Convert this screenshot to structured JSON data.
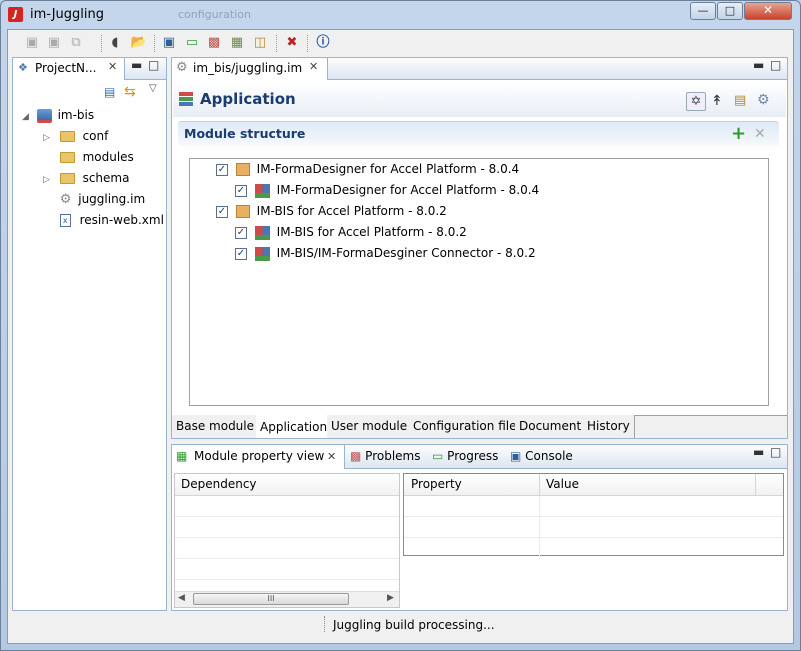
{
  "window": {
    "title": "im-Juggling",
    "ghost_tab": "configuration",
    "app_icon": "J"
  },
  "toolbar": {
    "icons": [
      "save-icon",
      "save-as-icon",
      "save-all-icon",
      "build-icon",
      "open-folder-icon",
      "deploy-icon",
      "add-module-icon",
      "user-config-icon",
      "image-icon",
      "hierarchy-icon",
      "tools-icon",
      "info-icon"
    ]
  },
  "project_view": {
    "tab_label": "ProjectN...",
    "tree": {
      "root": "im-bis",
      "children": [
        {
          "label": "conf",
          "expandable": true
        },
        {
          "label": "modules",
          "expandable": false
        },
        {
          "label": "schema",
          "expandable": true
        },
        {
          "label": "juggling.im",
          "expandable": false
        },
        {
          "label": "resin-web.xml",
          "expandable": false
        }
      ]
    }
  },
  "editor": {
    "tab_label": "im_bis/juggling.im",
    "form_title": "Application",
    "section_title": "Module structure",
    "modules": [
      {
        "label": "IM-FormaDesigner for Accel Platform - 8.0.4",
        "level": 0,
        "checked": true
      },
      {
        "label": "IM-FormaDesigner for Accel Platform - 8.0.4",
        "level": 1,
        "checked": true
      },
      {
        "label": "IM-BIS for Accel Platform - 8.0.2",
        "level": 0,
        "checked": true
      },
      {
        "label": "IM-BIS for Accel Platform - 8.0.2",
        "level": 1,
        "checked": true
      },
      {
        "label": "IM-BIS/IM-FormaDesginer Connector - 8.0.2",
        "level": 1,
        "checked": true
      }
    ],
    "bottom_tabs": [
      "Base module",
      "Application",
      "User module",
      "Configuration file",
      "Document",
      "History"
    ],
    "active_bottom_tab": "Application"
  },
  "property_view": {
    "tabs": [
      "Module property view",
      "Problems",
      "Progress",
      "Console"
    ],
    "dependency_header": "Dependency",
    "property_header": "Property",
    "value_header": "Value",
    "scroll_grip": "III"
  },
  "status_bar": {
    "text": "Juggling build processing..."
  },
  "colors": {
    "accent": "#1a3c6e",
    "view_border": "#99b4d1",
    "window_frame": "#b9d1ea"
  }
}
